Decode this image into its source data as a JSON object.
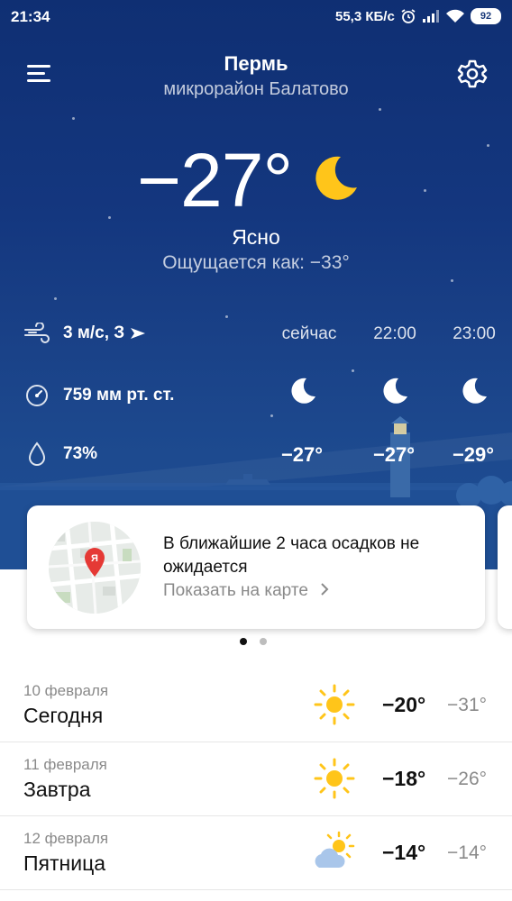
{
  "status_bar": {
    "time": "21:34",
    "speed": "55,3 КБ/с",
    "battery": "92"
  },
  "header": {
    "city": "Пермь",
    "district": "микрорайон Балатово"
  },
  "current": {
    "temperature": "−27°",
    "condition": "Ясно",
    "feels_like": "Ощущается как: −33°",
    "icon": "moon-icon"
  },
  "details": {
    "wind": "3 м/с, З",
    "pressure": "759 мм рт. ст.",
    "humidity": "73%"
  },
  "hourly": [
    {
      "label": "сейчас",
      "temp": "−27°",
      "icon": "moon-icon"
    },
    {
      "label": "22:00",
      "temp": "−27°",
      "icon": "moon-icon"
    },
    {
      "label": "23:00",
      "temp": "−29°",
      "icon": "moon-icon"
    }
  ],
  "precip_card": {
    "text": "В ближайшие 2 часа осадков не ожидается",
    "link": "Показать на карте",
    "map_marker": "Я"
  },
  "forecast": [
    {
      "date": "10 февраля",
      "day": "Сегодня",
      "high": "−20°",
      "low": "−31°",
      "icon": "sun-icon"
    },
    {
      "date": "11 февраля",
      "day": "Завтра",
      "high": "−18°",
      "low": "−26°",
      "icon": "sun-icon"
    },
    {
      "date": "12 февраля",
      "day": "Пятница",
      "high": "−14°",
      "low": "−14°",
      "icon": "partly-cloudy-icon"
    }
  ],
  "colors": {
    "accent_yellow": "#ffc51a",
    "sky_top": "#0f2f73",
    "sky_bottom": "#1e4d92",
    "marker_red": "#e53935"
  }
}
